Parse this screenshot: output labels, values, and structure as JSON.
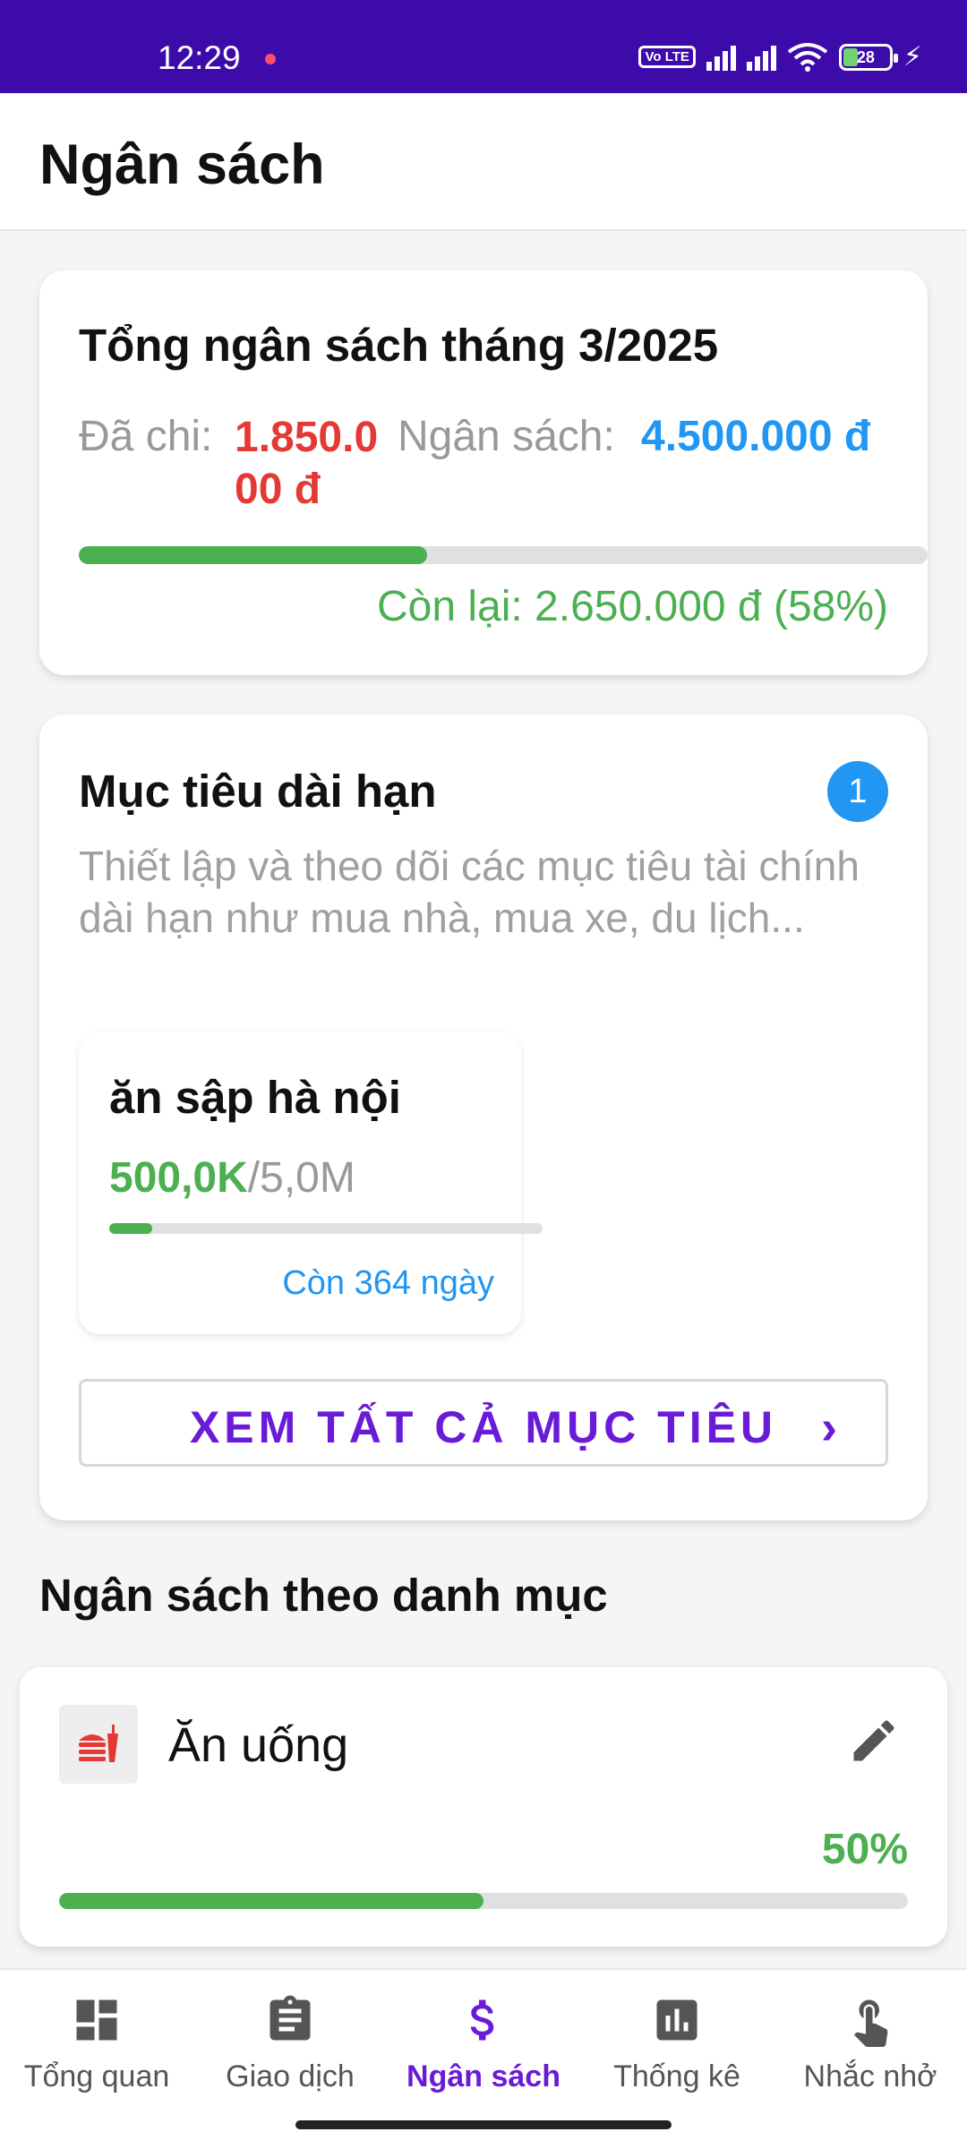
{
  "status_bar": {
    "time": "12:29",
    "volte": "Vo LTE",
    "battery": "28",
    "charging_symbol": "⚡"
  },
  "header": {
    "title": "Ngân sách"
  },
  "total_budget": {
    "title": "Tổng ngân sách tháng 3/2025",
    "spent_label": "Đã chi:",
    "spent_value": "1.850.000 đ",
    "budget_label": "Ngân sách:",
    "budget_value": "4.500.000 đ",
    "spent_fraction": 0.41,
    "remaining_text": "Còn lại: 2.650.000 đ (58%)"
  },
  "goals": {
    "title": "Mục tiêu dài hạn",
    "badge_count": "1",
    "description": "Thiết lập và theo dõi các mục tiêu tài chính dài hạn như mua nhà, mua xe, du lịch...",
    "items": [
      {
        "name": "ăn sập hà nội",
        "saved": "500,0K",
        "target": "/5,0M",
        "progress_fraction": 0.1,
        "days_left": "Còn 364 ngày"
      }
    ],
    "view_all_label": "XEM TẤT CẢ MỤC TIÊU",
    "view_all_chevron": "›"
  },
  "categories_section": {
    "title": "Ngân sách theo danh mục",
    "items": [
      {
        "name": "Ăn uống",
        "icon": "fastfood-icon",
        "percent_text": "50%",
        "progress_fraction": 0.5
      }
    ]
  },
  "bottom_nav": {
    "items": [
      {
        "label": "Tổng quan",
        "icon": "dashboard-icon",
        "active": false
      },
      {
        "label": "Giao dịch",
        "icon": "clipboard-icon",
        "active": false
      },
      {
        "label": "Ngân sách",
        "icon": "dollar-icon",
        "active": true
      },
      {
        "label": "Thống kê",
        "icon": "bar-chart-icon",
        "active": false
      },
      {
        "label": "Nhắc nhở",
        "icon": "touch-icon",
        "active": false
      }
    ]
  },
  "colors": {
    "status_bar": "#3e0bab",
    "accent_purple": "#6a1bd8",
    "spent_red": "#e53935",
    "budget_blue": "#2196f3",
    "progress_green": "#4caf50"
  }
}
